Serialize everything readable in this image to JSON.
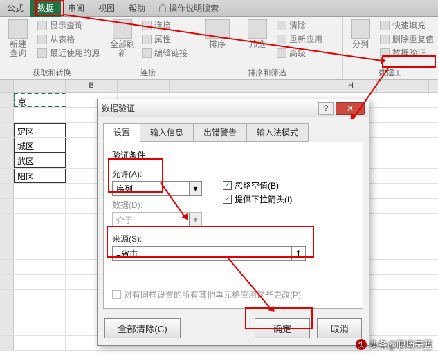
{
  "ribbon": {
    "tabs": [
      "公式",
      "数据",
      "审阅",
      "视图",
      "帮助"
    ],
    "active_tab": "数据",
    "tell_me": "操作说明搜索",
    "groups": {
      "get": {
        "label": "获取和转换",
        "big": "新建\n查询",
        "items": [
          "显示查询",
          "从表格",
          "最近使用的源"
        ]
      },
      "conn": {
        "label": "连接",
        "big": "全部刷新",
        "items": [
          "连接",
          "属性",
          "编辑链接"
        ]
      },
      "sort": {
        "label": "排序和筛选",
        "big": "排序",
        "filter": "筛选",
        "items": [
          "清除",
          "重新应用",
          "高级"
        ]
      },
      "tools": {
        "label": "数据工",
        "big": "分列",
        "items": [
          "快速填充",
          "删除重复值",
          "数据验证"
        ]
      }
    }
  },
  "sheet": {
    "col_headers": [
      "",
      "",
      "B",
      "",
      "",
      "",
      "",
      "H",
      ""
    ],
    "cells": [
      "京",
      "定区",
      "城区",
      "武区",
      "阳区"
    ]
  },
  "dialog": {
    "title": "数据验证",
    "tabs": [
      "设置",
      "输入信息",
      "出错警告",
      "输入法模式"
    ],
    "section": "验证条件",
    "allow_label": "允许(A):",
    "allow_value": "序列",
    "data_label": "数据(D):",
    "data_value": "介于",
    "chk_ignore": "忽略空值(B)",
    "chk_dropdown": "提供下拉箭头(I)",
    "source_label": "来源(S):",
    "source_value": "=省市",
    "apply_label": "对有同样设置的所有其他单元格应用这些更改(P)",
    "clear": "全部清除(C)",
    "ok": "确定",
    "cancel": "取消"
  },
  "watermark": "头条@职场天蓝"
}
